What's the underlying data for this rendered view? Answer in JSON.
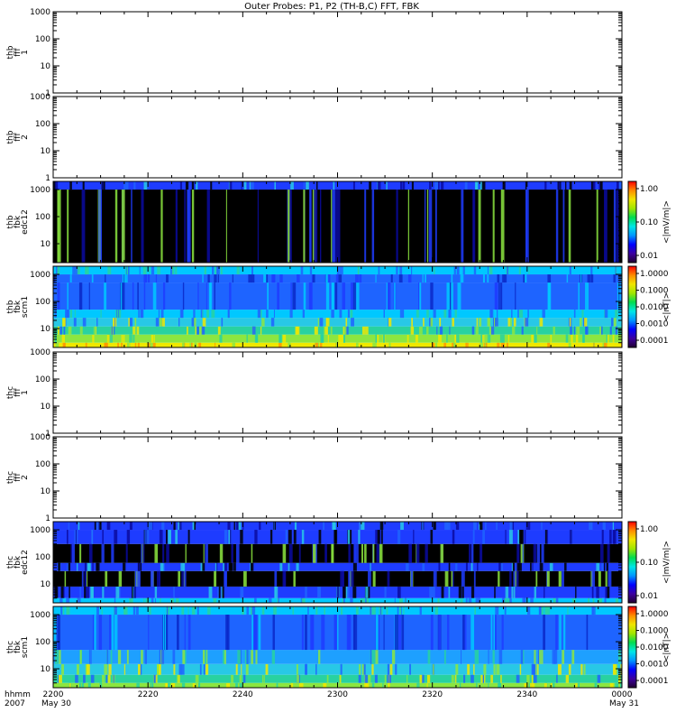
{
  "title": "Outer Probes: P1, P2 (TH-B,C) FFT, FBK",
  "time_axis": {
    "corner_label_1": "hhmm",
    "corner_label_2": "2007",
    "tick_labels": [
      "2200",
      "2220",
      "2240",
      "2300",
      "2320",
      "2340",
      "0000"
    ],
    "date_labels": [
      "May 30",
      "May 31"
    ]
  },
  "chart_data": [
    {
      "type": "heatmap",
      "panel": "thb-fff-1",
      "ylabel_lines": [
        "thb",
        "fff",
        "1"
      ],
      "yscale": "log",
      "ylim": [
        1,
        1000
      ],
      "ytick_labels": [
        "1",
        "10",
        "100",
        "1000"
      ],
      "data": "empty",
      "colorbar": null
    },
    {
      "type": "heatmap",
      "panel": "thb-fff-2",
      "ylabel_lines": [
        "thb",
        "fff",
        "2"
      ],
      "yscale": "log",
      "ylim": [
        1,
        1000
      ],
      "ytick_labels": [
        "1",
        "10",
        "100",
        "1000"
      ],
      "data": "empty",
      "colorbar": null
    },
    {
      "type": "heatmap",
      "panel": "thb-fbk-edc12",
      "ylabel_lines": [
        "thb",
        "fbk",
        "edc12"
      ],
      "yscale": "log",
      "ylim": [
        2,
        2000
      ],
      "ytick_labels": [
        "10",
        "100",
        "1000"
      ],
      "colorbar": {
        "label": "<|mV/m|>",
        "scale": "log",
        "tick_labels": [
          "0.01",
          "0.10",
          "1.00"
        ]
      },
      "bands": [
        {
          "low": 2,
          "high": 1000,
          "color": "#000000"
        },
        {
          "low": 1000,
          "high": 2000,
          "color": "#1e3cff"
        }
      ]
    },
    {
      "type": "heatmap",
      "panel": "thb-fbk-scm1",
      "ylabel_lines": [
        "thb",
        "fbk",
        "scm1"
      ],
      "yscale": "log",
      "ylim": [
        2,
        2000
      ],
      "ytick_labels": [
        "10",
        "100",
        "1000"
      ],
      "colorbar": {
        "label": "<|nT|>",
        "scale": "log",
        "tick_labels": [
          "0.0001",
          "0.0010",
          "0.0100",
          "0.1000",
          "1.0000"
        ]
      },
      "bands": [
        {
          "low": 2,
          "high": 3,
          "color": "#f0e800"
        },
        {
          "low": 3,
          "high": 6,
          "color": "#8ce640"
        },
        {
          "low": 6,
          "high": 12,
          "color": "#28d2a0"
        },
        {
          "low": 12,
          "high": 25,
          "color": "#28c8e6"
        },
        {
          "low": 25,
          "high": 50,
          "color": "#00c8ff"
        },
        {
          "low": 50,
          "high": 500,
          "color": "#1e64ff"
        },
        {
          "low": 500,
          "high": 1000,
          "color": "#1e64ff"
        },
        {
          "low": 1000,
          "high": 2000,
          "color": "#00c8ff"
        }
      ]
    },
    {
      "type": "heatmap",
      "panel": "thc-fff-1",
      "ylabel_lines": [
        "thc",
        "fff",
        "1"
      ],
      "yscale": "log",
      "ylim": [
        1,
        1000
      ],
      "ytick_labels": [
        "1",
        "10",
        "100",
        "1000"
      ],
      "data": "empty",
      "colorbar": null
    },
    {
      "type": "heatmap",
      "panel": "thc-fff-2",
      "ylabel_lines": [
        "thc",
        "fff",
        "2"
      ],
      "yscale": "log",
      "ylim": [
        1,
        1000
      ],
      "ytick_labels": [
        "1",
        "10",
        "100",
        "1000"
      ],
      "data": "empty",
      "colorbar": null
    },
    {
      "type": "heatmap",
      "panel": "thc-fbk-edc12",
      "ylabel_lines": [
        "thc",
        "fbk",
        "edc12"
      ],
      "yscale": "log",
      "ylim": [
        2,
        2000
      ],
      "ytick_labels": [
        "10",
        "100",
        "1000"
      ],
      "colorbar": {
        "label": "<|mV/m|>",
        "scale": "log",
        "tick_labels": [
          "0.01",
          "0.10",
          "1.00"
        ]
      },
      "bands": [
        {
          "low": 2,
          "high": 3,
          "color": "#00c8ff"
        },
        {
          "low": 3,
          "high": 8,
          "color": "#1e3cff"
        },
        {
          "low": 8,
          "high": 30,
          "color": "#000000"
        },
        {
          "low": 30,
          "high": 60,
          "color": "#1e3cff"
        },
        {
          "low": 60,
          "high": 300,
          "color": "#000000"
        },
        {
          "low": 300,
          "high": 1000,
          "color": "#1e3cff"
        },
        {
          "low": 1000,
          "high": 2000,
          "color": "#1e3cff"
        }
      ]
    },
    {
      "type": "heatmap",
      "panel": "thc-fbk-scm1",
      "ylabel_lines": [
        "thc",
        "fbk",
        "scm1"
      ],
      "yscale": "log",
      "ylim": [
        2,
        2000
      ],
      "ytick_labels": [
        "10",
        "100",
        "1000"
      ],
      "colorbar": {
        "label": "<|nT|>",
        "scale": "log",
        "tick_labels": [
          "0.0001",
          "0.0010",
          "0.0100",
          "0.1000",
          "1.0000"
        ]
      },
      "bands": [
        {
          "low": 2,
          "high": 3,
          "color": "#8ce640"
        },
        {
          "low": 3,
          "high": 6,
          "color": "#28d2a0"
        },
        {
          "low": 6,
          "high": 15,
          "color": "#28c8e6"
        },
        {
          "low": 15,
          "high": 50,
          "color": "#1ea0ff"
        },
        {
          "low": 50,
          "high": 1000,
          "color": "#1e64ff"
        },
        {
          "low": 1000,
          "high": 2000,
          "color": "#00c8ff"
        }
      ]
    }
  ]
}
